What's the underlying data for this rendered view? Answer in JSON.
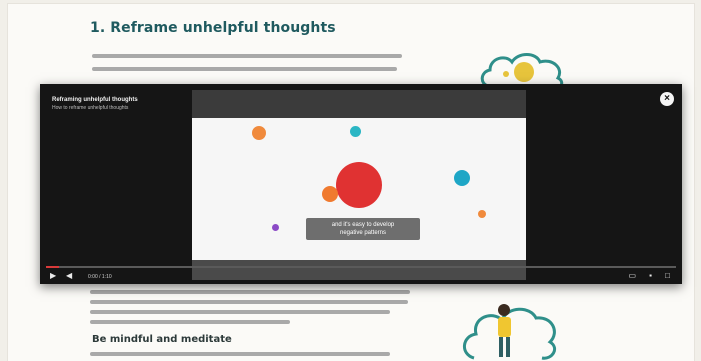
{
  "article": {
    "heading": "1. Reframe unhelpful thoughts",
    "sub_heading": "Be mindful and meditate"
  },
  "video": {
    "title": "Reframing unhelpful thoughts",
    "subtitle": "How to reframe unhelpful thoughts",
    "caption_line1": "and it's easy to develop",
    "caption_line2": "negative patterns",
    "close_label": "×",
    "progress": 0.02,
    "time": "0:00 / 1:10"
  },
  "colors": {
    "heading": "#1f5a5f",
    "player_bg": "#151515",
    "accent_red": "#e03232",
    "progress": "#d83a3a"
  },
  "icons": {
    "close": "close-icon",
    "play": "play-icon",
    "volume": "volume-icon",
    "captions": "captions-icon",
    "settings": "settings-icon",
    "fullscreen": "fullscreen-icon"
  }
}
